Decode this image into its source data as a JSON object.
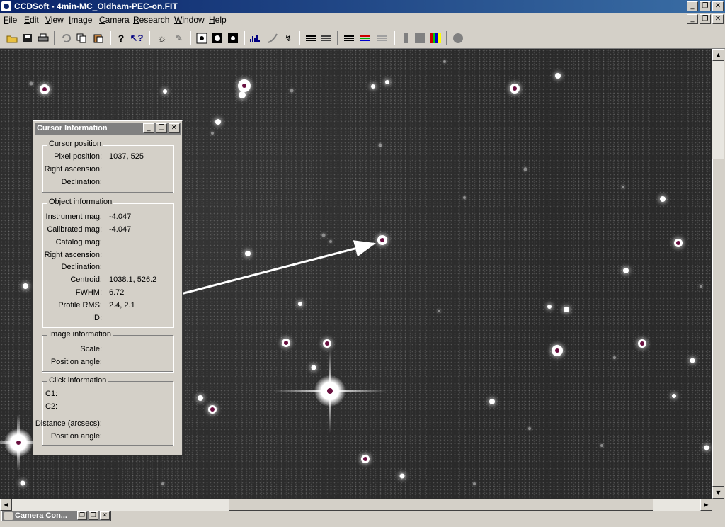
{
  "window": {
    "title": "CCDSoft  - 4min-MC_Oldham-PEC-on.FIT"
  },
  "menu": {
    "items": [
      {
        "label": "File",
        "underline": "F",
        "rest": "ile"
      },
      {
        "label": "Edit",
        "underline": "E",
        "rest": "dit"
      },
      {
        "label": "View",
        "underline": "V",
        "rest": "iew"
      },
      {
        "label": "Image",
        "underline": "I",
        "rest": "mage"
      },
      {
        "label": "Camera",
        "underline": "C",
        "rest": "amera"
      },
      {
        "label": "Research",
        "underline": "R",
        "rest": "esearch"
      },
      {
        "label": "Window",
        "underline": "W",
        "rest": "indow"
      },
      {
        "label": "Help",
        "underline": "H",
        "rest": "elp"
      }
    ]
  },
  "toolbar": {
    "buttons": [
      "open-icon",
      "save-icon",
      "print-icon",
      "undo-icon",
      "copy-icon",
      "paste-icon",
      "help-icon",
      "context-help-icon",
      "brightness-icon",
      "edit-icon",
      "stars-black-icon",
      "stars-outline-icon",
      "stars-white-icon",
      "histogram-icon",
      "curve-icon",
      "transform-icon",
      "layers-icon",
      "layers-alt-icon",
      "stack-icon",
      "color-stack-icon",
      "blink-icon",
      "grayscale-icon",
      "gray-box-icon",
      "color-icon",
      "circle-icon"
    ]
  },
  "cursor_info": {
    "title": "Cursor Information",
    "cursor_position": {
      "heading": "Cursor position",
      "pixel_position_label": "Pixel position:",
      "pixel_position_value": "1037, 525",
      "ra_label": "Right ascension:",
      "dec_label": "Declination:"
    },
    "object_information": {
      "heading": "Object information",
      "instrument_mag_label": "Instrument mag:",
      "instrument_mag_value": "-4.047",
      "calibrated_mag_label": "Calibrated mag:",
      "calibrated_mag_value": "-4.047",
      "catalog_mag_label": "Catalog mag:",
      "ra_label": "Right ascension:",
      "dec_label": "Declination:",
      "centroid_label": "Centroid:",
      "centroid_value": "1038.1, 526.2",
      "fwhm_label": "FWHM:",
      "fwhm_value": "6.72",
      "profile_rms_label": "Profile RMS:",
      "profile_rms_value": "2.4, 2.1",
      "id_label": "ID:"
    },
    "image_information": {
      "heading": "Image information",
      "scale_label": "Scale:",
      "position_angle_label": "Position angle:"
    },
    "click_information": {
      "heading": "Click information",
      "c1_label": "C1:",
      "c2_label": "C2:",
      "distance_label": "Distance (arcsecs):",
      "position_angle_label": "Position angle:"
    }
  },
  "camera_window": {
    "title": "Camera Con..."
  },
  "window_buttons": {
    "minimize": "_",
    "restore": "❐",
    "close": "✕"
  }
}
